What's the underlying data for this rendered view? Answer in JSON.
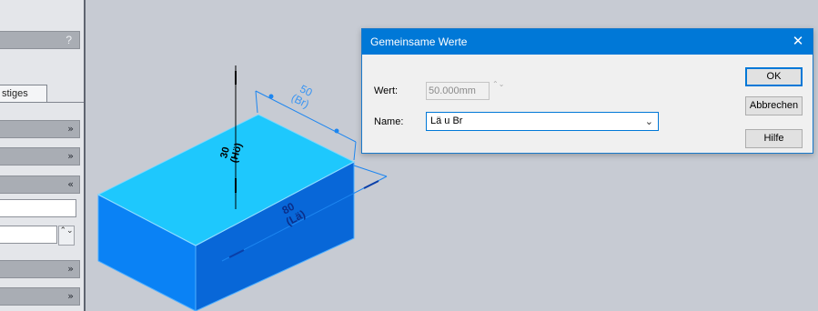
{
  "left_panel": {
    "help_label": "?",
    "tab_label": "stiges",
    "chevrons": [
      "»",
      "»",
      "«",
      "»",
      "»"
    ],
    "spinner": "⌃⌄"
  },
  "dimensions": {
    "width_value": "50",
    "width_name": "(Br)",
    "height_value": "30",
    "height_name": "(Hö)",
    "length_value": "80",
    "length_name": "(Lä)"
  },
  "dialog": {
    "title": "Gemeinsame Werte",
    "close_glyph": "✕",
    "wert_label": "Wert:",
    "wert_value": "50.000mm",
    "wert_spinner": "⌃⌄",
    "name_label": "Name:",
    "name_value": "Lä u Br",
    "dropdown_glyph": "⌄",
    "ok_label": "OK",
    "cancel_label": "Abbrechen",
    "help_label": "Hilfe"
  },
  "colors": {
    "box_top": "#1ec8fd",
    "box_front": "#0a82f5",
    "box_side": "#0867d8",
    "dimension_line": "#1d86f0",
    "dialog_titlebar": "#0078d7"
  }
}
